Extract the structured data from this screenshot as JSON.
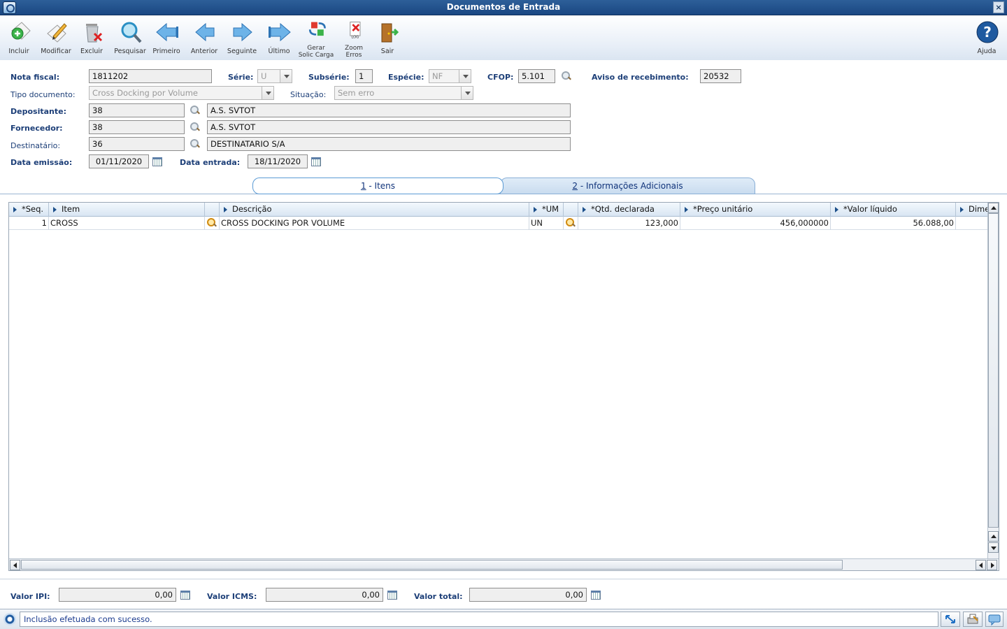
{
  "window": {
    "title": "Documentos de Entrada"
  },
  "toolbar": {
    "incluir": "Incluir",
    "modificar": "Modificar",
    "excluir": "Excluir",
    "pesquisar": "Pesquisar",
    "primeiro": "Primeiro",
    "anterior": "Anterior",
    "seguinte": "Seguinte",
    "ultimo": "Último",
    "gerar_1": "Gerar",
    "gerar_2": "Solic Carga",
    "zoom_1": "Zoom",
    "zoom_2": "Erros",
    "log": "LOG",
    "sair": "Sair",
    "ajuda": "Ajuda"
  },
  "form": {
    "nota_fiscal_label": "Nota fiscal:",
    "nota_fiscal": "1811202",
    "serie_label": "Série:",
    "serie": "U",
    "subserie_label": "Subsérie:",
    "subserie": "1",
    "especie_label": "Espécie:",
    "especie": "NF",
    "cfop_label": "CFOP:",
    "cfop": "5.101",
    "aviso_label": "Aviso de recebimento:",
    "aviso": "20532",
    "tipo_doc_label": "Tipo documento:",
    "tipo_doc": "Cross Docking por Volume",
    "situacao_label": "Situação:",
    "situacao": "Sem erro",
    "depositante_label": "Depositante:",
    "depositante_cod": "38",
    "depositante_nome": "A.S. SVTOT",
    "fornecedor_label": "Fornecedor:",
    "fornecedor_cod": "38",
    "fornecedor_nome": "A.S. SVTOT",
    "destinatario_label": "Destinatário:",
    "destinatario_cod": "36",
    "destinatario_nome": "DESTINATARIO S/A",
    "data_emissao_label": "Data emissão:",
    "data_emissao": "01/11/2020",
    "data_entrada_label": "Data entrada:",
    "data_entrada": "18/11/2020"
  },
  "tabs": {
    "itens_num": "1",
    "itens": " - Itens",
    "info_num": "2",
    "info": " - Informações Adicionais"
  },
  "grid": {
    "headers": {
      "seq": "*Seq.",
      "item": "Item",
      "descricao": "Descrição",
      "um": "*UM",
      "qtd": "*Qtd. declarada",
      "preco": "*Preço unitário",
      "valor": "*Valor líquido",
      "dime": "Dime"
    },
    "rows": [
      {
        "seq": "1",
        "item": "CROSS",
        "descricao": "CROSS DOCKING POR VOLUME",
        "um": "UN",
        "qtd": "123,000",
        "preco": "456,000000",
        "valor": "56.088,00"
      }
    ]
  },
  "totals": {
    "ipi_label": "Valor IPI:",
    "ipi": "0,00",
    "icms_label": "Valor ICMS:",
    "icms": "0,00",
    "total_label": "Valor total:",
    "total": "0,00"
  },
  "status": {
    "message": "Inclusão efetuada com sucesso."
  }
}
